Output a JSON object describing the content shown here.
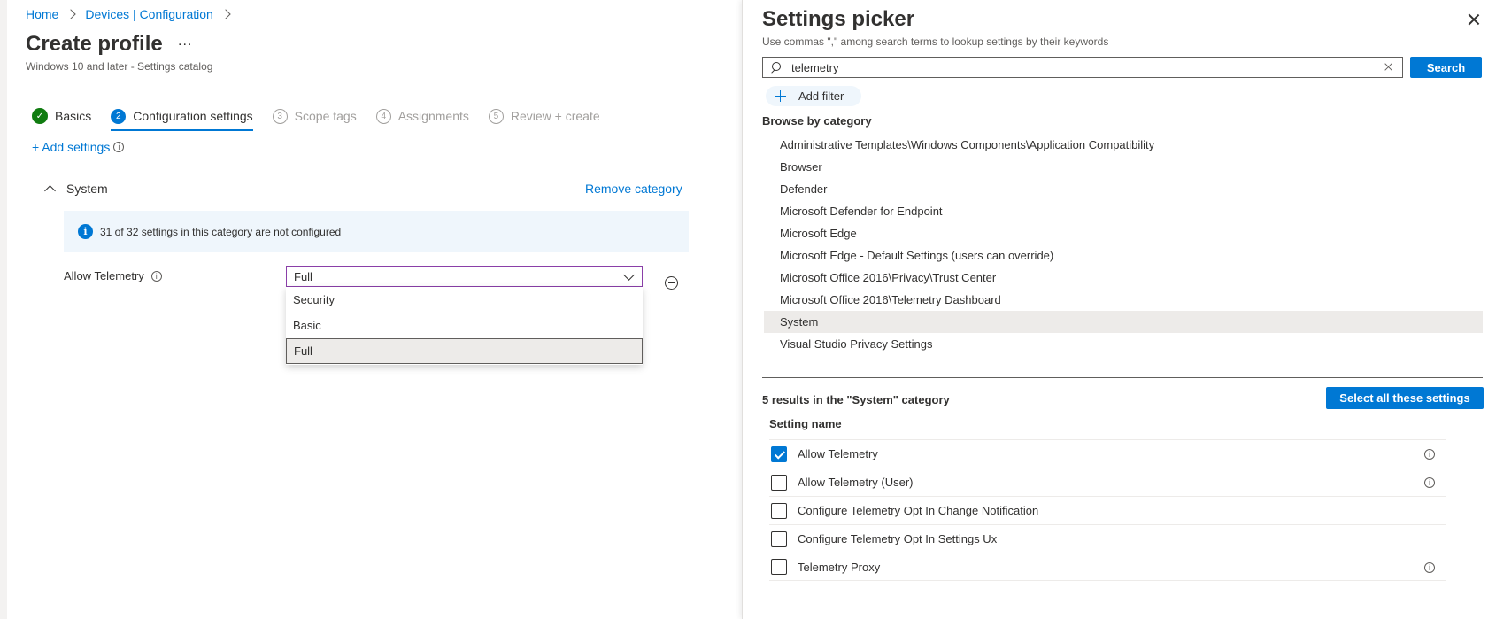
{
  "breadcrumb": [
    {
      "label": "Home"
    },
    {
      "label": "Devices | Configuration"
    }
  ],
  "page": {
    "title": "Create profile",
    "more_label": "...",
    "subtitle": "Windows 10 and later - Settings catalog"
  },
  "wizard": {
    "steps": [
      {
        "num": "✓",
        "label": "Basics",
        "state": "done"
      },
      {
        "num": "2",
        "label": "Configuration settings",
        "state": "active"
      },
      {
        "num": "3",
        "label": "Scope tags",
        "state": "pending"
      },
      {
        "num": "4",
        "label": "Assignments",
        "state": "pending"
      },
      {
        "num": "5",
        "label": "Review + create",
        "state": "pending"
      }
    ]
  },
  "config": {
    "add_settings_label": "+ Add settings",
    "category_name": "System",
    "remove_category_label": "Remove category",
    "info_message": "31 of 32 settings in this category are not configured",
    "setting_label": "Allow Telemetry",
    "setting_value": "Full",
    "dropdown_options": [
      "Security",
      "Basic",
      "Full"
    ],
    "dropdown_selected": "Full"
  },
  "picker": {
    "title": "Settings picker",
    "hint": "Use commas \",\" among search terms to lookup settings by their keywords",
    "search_value": "telemetry",
    "search_button": "Search",
    "add_filter_label": "Add filter",
    "browse_label": "Browse by category",
    "categories": [
      "Administrative Templates\\Windows Components\\Application Compatibility",
      "Browser",
      "Defender",
      "Microsoft Defender for Endpoint",
      "Microsoft Edge",
      "Microsoft Edge - Default Settings (users can override)",
      "Microsoft Office 2016\\Privacy\\Trust Center",
      "Microsoft Office 2016\\Telemetry Dashboard",
      "System",
      "Visual Studio Privacy Settings"
    ],
    "selected_category": "System",
    "results_label": "5 results in the \"System\" category",
    "select_all_label": "Select all these settings",
    "column_header": "Setting name",
    "results": [
      {
        "name": "Allow Telemetry",
        "checked": true,
        "info": true
      },
      {
        "name": "Allow Telemetry (User)",
        "checked": false,
        "info": true
      },
      {
        "name": "Configure Telemetry Opt In Change Notification",
        "checked": false,
        "info": false
      },
      {
        "name": "Configure Telemetry Opt In Settings Ux",
        "checked": false,
        "info": false
      },
      {
        "name": "Telemetry Proxy",
        "checked": false,
        "info": true
      }
    ]
  },
  "colors": {
    "accent": "#0078d4",
    "success": "#107c10",
    "info_bg": "#eff6fc",
    "focus_border": "#8a3fa8"
  }
}
